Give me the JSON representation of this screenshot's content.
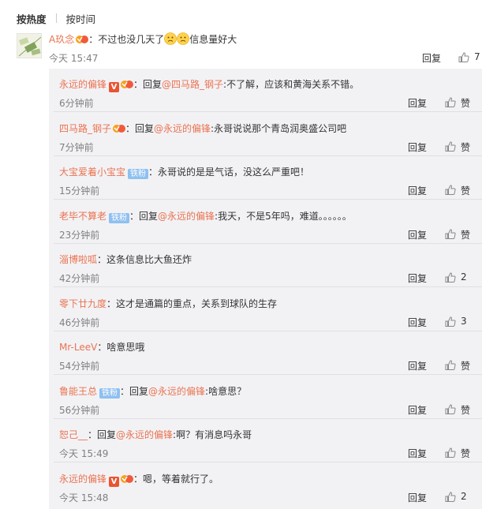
{
  "tabs": {
    "hot": "按热度",
    "time": "按时间"
  },
  "main": {
    "user": "A玖念",
    "colon": "：",
    "text_before": "不过也没几天了",
    "text_after": "信息量好大",
    "time": "今天 15:47",
    "reply": "回复",
    "likes": "7"
  },
  "replies": [
    {
      "user": "永远的偏锋",
      "v_badge": "V",
      "vip": true,
      "fan": "",
      "prefix": "：回复",
      "mention": "@四马路_钢子",
      "text": ":不了解，应该和黄海关系不错。",
      "time": "6分钟前",
      "reply": "回复",
      "like": "赞"
    },
    {
      "user": "四马路_钢子",
      "v_badge": "",
      "vip": true,
      "fan": "",
      "prefix": "：回复",
      "mention": "@永远的偏锋",
      "text": ":永哥说说那个青岛润奥盛公司吧",
      "time": "7分钟前",
      "reply": "回复",
      "like": "赞"
    },
    {
      "user": "大宝爱着小宝宝",
      "v_badge": "",
      "vip": false,
      "fan": "铁粉",
      "prefix": "：",
      "mention": "",
      "text": "永哥说的是是气话，没这么严重吧！",
      "time": "15分钟前",
      "reply": "回复",
      "like": "赞"
    },
    {
      "user": "老毕不算老",
      "v_badge": "",
      "vip": false,
      "fan": "铁粉",
      "prefix": "：回复",
      "mention": "@永远的偏锋",
      "text": ":我天，不是5年吗，难道。。。。。。",
      "time": "23分钟前",
      "reply": "回复",
      "like": "赞"
    },
    {
      "user": "淄博啦呱",
      "v_badge": "",
      "vip": false,
      "fan": "",
      "prefix": "：",
      "mention": "",
      "text": "这条信息比大鱼还炸",
      "time": "42分钟前",
      "reply": "回复",
      "like": "2"
    },
    {
      "user": "零下廿九度",
      "v_badge": "",
      "vip": false,
      "fan": "",
      "prefix": "：",
      "mention": "",
      "text": "这才是通篇的重点，关系到球队的生存",
      "time": "46分钟前",
      "reply": "回复",
      "like": "3"
    },
    {
      "user": "Mr-LeeV",
      "v_badge": "",
      "vip": false,
      "fan": "",
      "prefix": "：",
      "mention": "",
      "text": "啥意思哦",
      "time": "54分钟前",
      "reply": "回复",
      "like": "赞"
    },
    {
      "user": "鲁能王总",
      "v_badge": "",
      "vip": false,
      "fan": "铁粉",
      "prefix": "：回复",
      "mention": "@永远的偏锋",
      "text": ":啥意思？",
      "time": "56分钟前",
      "reply": "回复",
      "like": "赞"
    },
    {
      "user": "恕己__",
      "v_badge": "",
      "vip": false,
      "fan": "",
      "prefix": "：回复",
      "mention": "@永远的偏锋",
      "text": ":啊？有消息吗永哥",
      "time": "今天 15:49",
      "reply": "回复",
      "like": "赞"
    },
    {
      "user": "永远的偏锋",
      "v_badge": "V",
      "vip": true,
      "fan": "",
      "prefix": "：",
      "mention": "",
      "text": "嗯，等着就行了。",
      "time": "今天 15:48",
      "reply": "回复",
      "like": "2"
    }
  ]
}
